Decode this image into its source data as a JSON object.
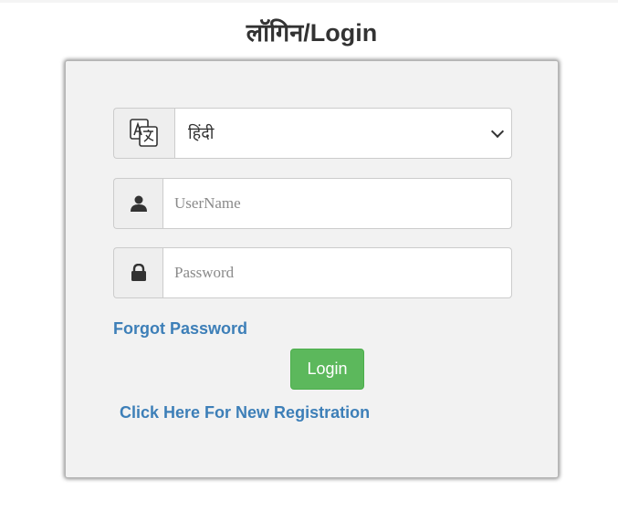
{
  "page": {
    "title": "लॉगिन/Login"
  },
  "form": {
    "language": {
      "icon": "translate-icon",
      "selected": "हिंदी"
    },
    "username": {
      "icon": "user-icon",
      "value": "",
      "placeholder": "UserName"
    },
    "password": {
      "icon": "lock-icon",
      "value": "",
      "placeholder": "Password"
    },
    "forgot_password_label": "Forgot Password",
    "login_label": "Login",
    "register_label": "Click Here For New Registration"
  },
  "colors": {
    "link": "#3d7fb8",
    "login_button": "#5cb85c",
    "panel_bg": "#f2f2f2",
    "title_text": "#333333"
  }
}
